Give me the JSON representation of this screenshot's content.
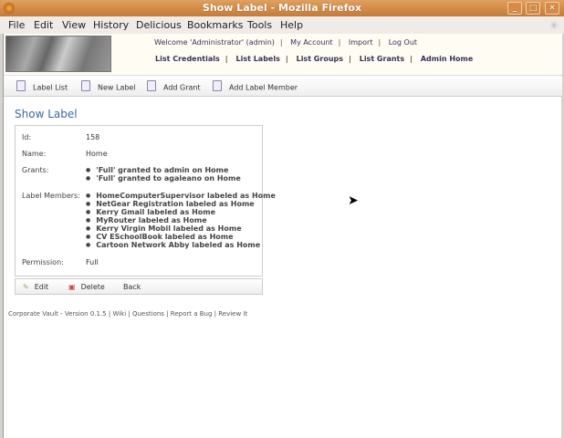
{
  "window": {
    "title": "Show Label - Mozilla Firefox"
  },
  "menu": [
    "File",
    "Edit",
    "View",
    "History",
    "Delicious",
    "Bookmarks",
    "Tools",
    "Help"
  ],
  "header": {
    "user_links": [
      "Welcome 'Administrator' (admin)",
      "My Account",
      "Import",
      "Log Out"
    ],
    "nav_links": [
      "List Credentials",
      "List Labels",
      "List Groups",
      "List Grants",
      "Admin Home"
    ]
  },
  "toolbar": [
    "Label List",
    "New Label",
    "Add Grant",
    "Add Label Member"
  ],
  "page_title": "Show Label",
  "details": {
    "id_label": "Id:",
    "id": "158",
    "name_label": "Name:",
    "name": "Home",
    "grants_label": "Grants:",
    "grants": [
      "'Full' granted to admin on Home",
      "'Full' granted to agaleano on Home"
    ],
    "members_label": "Label Members:",
    "members": [
      "HomeComputerSupervisor labeled as Home",
      "NetGear Registration labeled as Home",
      "Kerry Gmail labeled as Home",
      "MyRouter labeled as Home",
      "Kerry Virgin Mobil labeled as Home",
      "CV ESchoolBook labeled as Home",
      "Cartoon Network Abby labeled as Home"
    ],
    "permission_label": "Permission:",
    "permission": "Full"
  },
  "actions": [
    "Edit",
    "Delete",
    "Back"
  ],
  "footer": [
    "Corporate Vault - Version 0.1.5",
    "Wiki",
    "Questions",
    "Report a Bug",
    "Review It"
  ]
}
